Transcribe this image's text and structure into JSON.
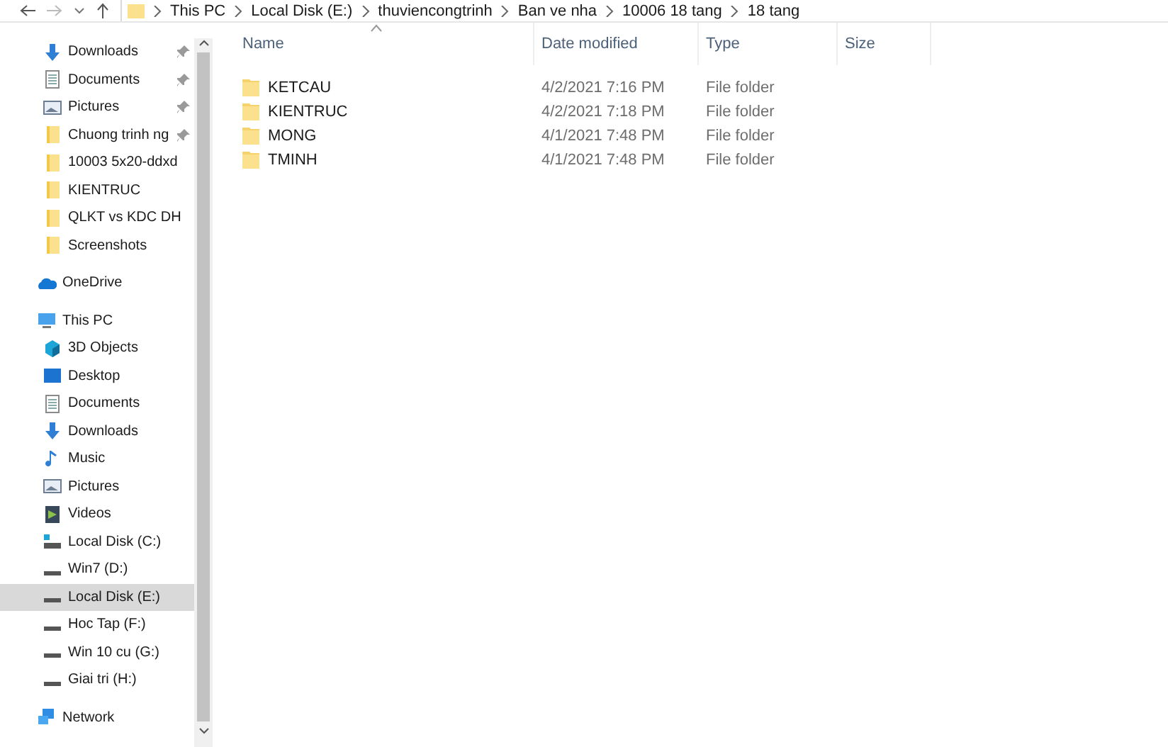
{
  "address_bar": {
    "crumbs": [
      "This PC",
      "Local Disk (E:)",
      "thuviencongtrinh",
      "Ban ve nha",
      "10006 18 tang",
      "18 tang"
    ]
  },
  "sidebar": {
    "quick_access": [
      {
        "label": "Downloads",
        "kind": "download",
        "pinned": true,
        "selected": false
      },
      {
        "label": "Documents",
        "kind": "document",
        "pinned": true,
        "selected": false
      },
      {
        "label": "Pictures",
        "kind": "picture",
        "pinned": true,
        "selected": false
      },
      {
        "label": "Chuong trinh ng",
        "kind": "folder",
        "pinned": true,
        "selected": false
      },
      {
        "label": "10003 5x20-ddxd",
        "kind": "folder",
        "pinned": false,
        "selected": false
      },
      {
        "label": "KIENTRUC",
        "kind": "folder",
        "pinned": false,
        "selected": false
      },
      {
        "label": "QLKT vs KDC DH",
        "kind": "folder",
        "pinned": false,
        "selected": false
      },
      {
        "label": "Screenshots",
        "kind": "folder",
        "pinned": false,
        "selected": false
      }
    ],
    "items": [
      {
        "label": "OneDrive",
        "kind": "cloud",
        "selected": false
      },
      {
        "label": "This PC",
        "kind": "pc",
        "selected": false,
        "children": [
          {
            "label": "3D Objects",
            "kind": "cube",
            "selected": false
          },
          {
            "label": "Desktop",
            "kind": "desktop",
            "selected": false
          },
          {
            "label": "Documents",
            "kind": "document",
            "selected": false
          },
          {
            "label": "Downloads",
            "kind": "download",
            "selected": false
          },
          {
            "label": "Music",
            "kind": "music",
            "selected": false
          },
          {
            "label": "Pictures",
            "kind": "picture",
            "selected": false
          },
          {
            "label": "Videos",
            "kind": "video",
            "selected": false
          },
          {
            "label": "Local Disk (C:)",
            "kind": "osdrive",
            "selected": false
          },
          {
            "label": "Win7 (D:)",
            "kind": "drive",
            "selected": false
          },
          {
            "label": "Local Disk (E:)",
            "kind": "drive",
            "selected": true
          },
          {
            "label": "Hoc Tap (F:)",
            "kind": "drive",
            "selected": false
          },
          {
            "label": "Win 10 cu (G:)",
            "kind": "drive",
            "selected": false
          },
          {
            "label": "Giai tri (H:)",
            "kind": "drive",
            "selected": false
          }
        ]
      },
      {
        "label": "Network",
        "kind": "network",
        "selected": false
      }
    ]
  },
  "file_list": {
    "columns": [
      "Name",
      "Date modified",
      "Type",
      "Size"
    ],
    "rows": [
      {
        "name": "KETCAU",
        "date": "4/2/2021 7:16 PM",
        "type": "File folder"
      },
      {
        "name": "KIENTRUC",
        "date": "4/2/2021 7:18 PM",
        "type": "File folder"
      },
      {
        "name": "MONG",
        "date": "4/1/2021 7:48 PM",
        "type": "File folder"
      },
      {
        "name": "TMINH",
        "date": "4/1/2021 7:48 PM",
        "type": "File folder"
      }
    ]
  }
}
